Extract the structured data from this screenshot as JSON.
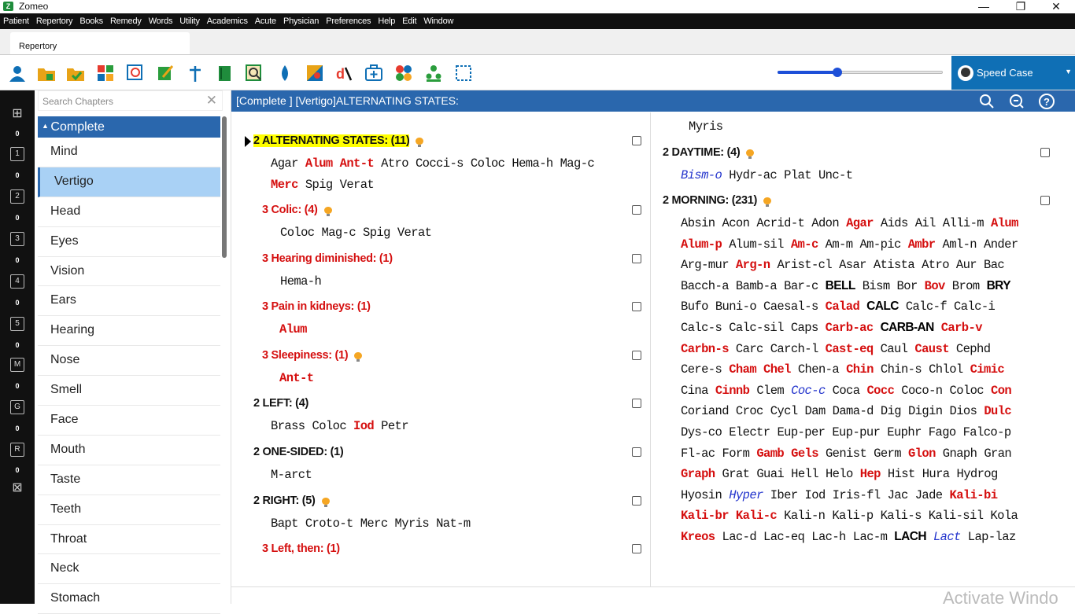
{
  "app": {
    "title": "Zomeo"
  },
  "menu": [
    "Patient",
    "Repertory",
    "Books",
    "Remedy",
    "Words",
    "Utility",
    "Academics",
    "Acute",
    "Physician",
    "Preferences",
    "Help",
    "Edit",
    "Window"
  ],
  "tab": {
    "label": "Repertory"
  },
  "toolbar": {
    "slider_value": 0.36,
    "speed_case_label": "Speed Case"
  },
  "leftrail": {
    "counts": [
      "0",
      "0",
      "0",
      "0",
      "0",
      "0",
      "0",
      "0",
      "0"
    ],
    "icons": [
      "1",
      "2",
      "3",
      "4",
      "5",
      "M",
      "G",
      "R"
    ]
  },
  "chapters": {
    "search_placeholder": "Search Chapters",
    "header": "Complete",
    "items": [
      "Mind",
      "Vertigo",
      "Head",
      "Eyes",
      "Vision",
      "Ears",
      "Hearing",
      "Nose",
      "Smell",
      "Face",
      "Mouth",
      "Taste",
      "Teeth",
      "Throat",
      "Neck",
      "Stomach"
    ],
    "selected": "Vertigo"
  },
  "content": {
    "breadcrumb": "[Complete ] [Vertigo]ALTERNATING STATES:"
  },
  "left_column": [
    {
      "title": "2 ALTERNATING STATES: (11)",
      "style": "hl",
      "bulb": true,
      "remedies": [
        [
          [
            "Agar",
            1
          ],
          [
            "Alum",
            3
          ],
          [
            "Ant-t",
            3
          ],
          [
            "Atro",
            1
          ],
          [
            "Cocci-s",
            1
          ],
          [
            "Coloc",
            1
          ],
          [
            "Hema-h",
            1
          ],
          [
            "Mag-c",
            1
          ]
        ],
        [
          [
            "Merc",
            3
          ],
          [
            "Spig",
            1
          ],
          [
            "Verat",
            1
          ]
        ]
      ]
    },
    {
      "title": "3 Colic: (4)",
      "style": "red",
      "bulb": true,
      "remedies": [
        [
          [
            "Coloc",
            1
          ],
          [
            "Mag-c",
            1
          ],
          [
            "Spig",
            1
          ],
          [
            "Verat",
            1
          ]
        ]
      ]
    },
    {
      "title": "3 Hearing diminished: (1)",
      "style": "red",
      "bulb": false,
      "remedies": [
        [
          [
            "Hema-h",
            1
          ]
        ]
      ]
    },
    {
      "title": "3 Pain in kidneys: (1)",
      "style": "red",
      "bulb": false,
      "remedies": [
        [
          [
            "Alum",
            3
          ]
        ]
      ]
    },
    {
      "title": "3 Sleepiness: (1)",
      "style": "red",
      "bulb": true,
      "remedies": [
        [
          [
            "Ant-t",
            3
          ]
        ]
      ]
    },
    {
      "title": "2 LEFT: (4)",
      "style": "black",
      "bulb": false,
      "remedies": [
        [
          [
            "Brass",
            1
          ],
          [
            "Coloc",
            1
          ],
          [
            "Iod",
            3
          ],
          [
            "Petr",
            1
          ]
        ]
      ]
    },
    {
      "title": "2 ONE-SIDED: (1)",
      "style": "black",
      "bulb": false,
      "remedies": [
        [
          [
            "M-arct",
            1
          ]
        ]
      ]
    },
    {
      "title": "2 RIGHT: (5)",
      "style": "black",
      "bulb": true,
      "remedies": [
        [
          [
            "Bapt",
            1
          ],
          [
            "Croto-t",
            1
          ],
          [
            "Merc",
            1
          ],
          [
            "Myris",
            1
          ],
          [
            "Nat-m",
            1
          ]
        ]
      ]
    },
    {
      "title": "3 Left, then: (1)",
      "style": "red",
      "bulb": false,
      "remedies": []
    }
  ],
  "right_column": {
    "top_remedy": "Myris",
    "rubrics": [
      {
        "title": "2 DAYTIME: (4)",
        "bulb": true,
        "remedies": [
          [
            [
              "Bism-o",
              2
            ],
            [
              "Hydr-ac",
              1
            ],
            [
              "Plat",
              1
            ],
            [
              "Unc-t",
              1
            ]
          ]
        ]
      },
      {
        "title": "2 MORNING: (231)",
        "bulb": true,
        "remedies": [
          [
            [
              "Absin",
              1
            ],
            [
              "Acon",
              1
            ],
            [
              "Acrid-t",
              1
            ],
            [
              "Adon",
              1
            ],
            [
              "Agar",
              3
            ],
            [
              "Aids",
              1
            ],
            [
              "Ail",
              1
            ],
            [
              "Alli-m",
              1
            ],
            [
              "Alum",
              3
            ]
          ],
          [
            [
              "Alum-p",
              3
            ],
            [
              "Alum-sil",
              1
            ],
            [
              "Am-c",
              3
            ],
            [
              "Am-m",
              1
            ],
            [
              "Am-pic",
              1
            ],
            [
              "Ambr",
              3
            ],
            [
              "Aml-n",
              1
            ],
            [
              "Ander",
              1
            ]
          ],
          [
            [
              "Arg-mur",
              1
            ],
            [
              "Arg-n",
              3
            ],
            [
              "Arist-cl",
              1
            ],
            [
              "Asar",
              1
            ],
            [
              "Atista",
              1
            ],
            [
              "Atro",
              1
            ],
            [
              "Aur",
              1
            ],
            [
              "Bac",
              1
            ]
          ],
          [
            [
              "Bacch-a",
              1
            ],
            [
              "Bamb-a",
              1
            ],
            [
              "Bar-c",
              1
            ],
            [
              "BELL",
              4
            ],
            [
              "Bism",
              1
            ],
            [
              "Bor",
              1
            ],
            [
              "Bov",
              3
            ],
            [
              "Brom",
              1
            ],
            [
              "BRY",
              4
            ]
          ],
          [
            [
              "Bufo",
              1
            ],
            [
              "Buni-o",
              1
            ],
            [
              "Caesal-s",
              1
            ],
            [
              "Calad",
              3
            ],
            [
              "CALC",
              4
            ],
            [
              "Calc-f",
              1
            ],
            [
              "Calc-i",
              1
            ]
          ],
          [
            [
              "Calc-s",
              1
            ],
            [
              "Calc-sil",
              1
            ],
            [
              "Caps",
              1
            ],
            [
              "Carb-ac",
              3
            ],
            [
              "CARB-AN",
              4
            ],
            [
              "Carb-v",
              3
            ]
          ],
          [
            [
              "Carbn-s",
              3
            ],
            [
              "Carc",
              1
            ],
            [
              "Carch-l",
              1
            ],
            [
              "Cast-eq",
              3
            ],
            [
              "Caul",
              1
            ],
            [
              "Caust",
              3
            ],
            [
              "Cephd",
              1
            ]
          ],
          [
            [
              "Cere-s",
              1
            ],
            [
              "Cham",
              3
            ],
            [
              "Chel",
              3
            ],
            [
              "Chen-a",
              1
            ],
            [
              "Chin",
              3
            ],
            [
              "Chin-s",
              1
            ],
            [
              "Chlol",
              1
            ],
            [
              "Cimic",
              3
            ]
          ],
          [
            [
              "Cina",
              1
            ],
            [
              "Cinnb",
              3
            ],
            [
              "Clem",
              1
            ],
            [
              "Coc-c",
              2
            ],
            [
              "Coca",
              1
            ],
            [
              "Cocc",
              3
            ],
            [
              "Coco-n",
              1
            ],
            [
              "Coloc",
              1
            ],
            [
              "Con",
              3
            ]
          ],
          [
            [
              "Coriand",
              1
            ],
            [
              "Croc",
              1
            ],
            [
              "Cycl",
              1
            ],
            [
              "Dam",
              1
            ],
            [
              "Dama-d",
              1
            ],
            [
              "Dig",
              1
            ],
            [
              "Digin",
              1
            ],
            [
              "Dios",
              1
            ],
            [
              "Dulc",
              3
            ]
          ],
          [
            [
              "Dys-co",
              1
            ],
            [
              "Electr",
              1
            ],
            [
              "Eup-per",
              1
            ],
            [
              "Eup-pur",
              1
            ],
            [
              "Euphr",
              1
            ],
            [
              "Fago",
              1
            ],
            [
              "Falco-p",
              1
            ]
          ],
          [
            [
              "Fl-ac",
              1
            ],
            [
              "Form",
              1
            ],
            [
              "Gamb",
              3
            ],
            [
              "Gels",
              3
            ],
            [
              "Genist",
              1
            ],
            [
              "Germ",
              1
            ],
            [
              "Glon",
              3
            ],
            [
              "Gnaph",
              1
            ],
            [
              "Gran",
              1
            ]
          ],
          [
            [
              "Graph",
              3
            ],
            [
              "Grat",
              1
            ],
            [
              "Guai",
              1
            ],
            [
              "Hell",
              1
            ],
            [
              "Helo",
              1
            ],
            [
              "Hep",
              3
            ],
            [
              "Hist",
              1
            ],
            [
              "Hura",
              1
            ],
            [
              "Hydrog",
              1
            ]
          ],
          [
            [
              "Hyosin",
              1
            ],
            [
              "Hyper",
              2
            ],
            [
              "Iber",
              1
            ],
            [
              "Iod",
              1
            ],
            [
              "Iris-fl",
              1
            ],
            [
              "Jac",
              1
            ],
            [
              "Jade",
              1
            ],
            [
              "Kali-bi",
              3
            ]
          ],
          [
            [
              "Kali-br",
              3
            ],
            [
              "Kali-c",
              3
            ],
            [
              "Kali-n",
              1
            ],
            [
              "Kali-p",
              1
            ],
            [
              "Kali-s",
              1
            ],
            [
              "Kali-sil",
              1
            ],
            [
              "Kola",
              1
            ]
          ],
          [
            [
              "Kreos",
              3
            ],
            [
              "Lac-d",
              1
            ],
            [
              "Lac-eq",
              1
            ],
            [
              "Lac-h",
              1
            ],
            [
              "Lac-m",
              1
            ],
            [
              "LACH",
              4
            ],
            [
              "Lact",
              2
            ],
            [
              "Lap-laz",
              1
            ]
          ]
        ]
      }
    ]
  },
  "watermark": "Activate Windo",
  "colors": {
    "accent": "#2a67ad",
    "grade3": "#d50f0f",
    "grade2": "#2233cc",
    "highlight": "#ffff00",
    "speedcase": "#0f6fb5"
  }
}
